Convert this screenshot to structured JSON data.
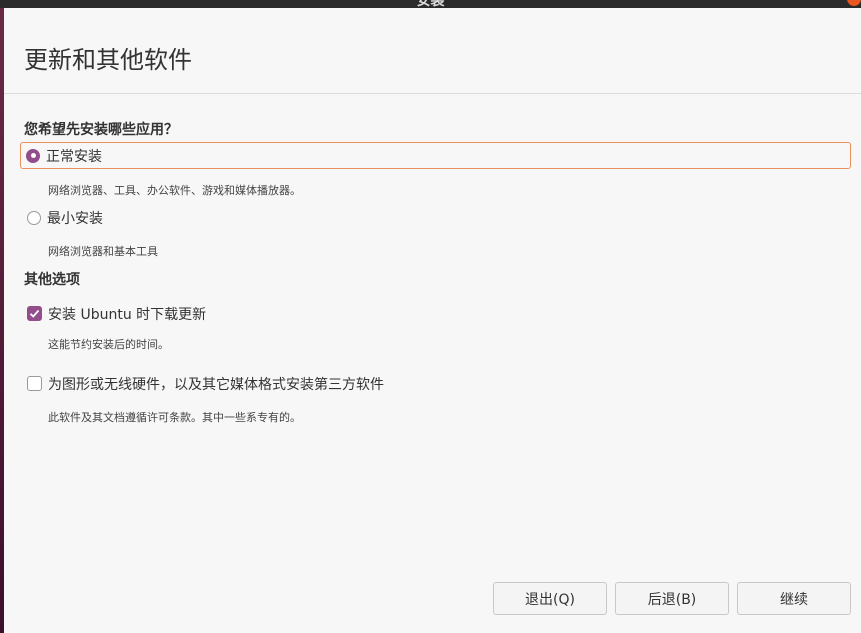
{
  "window": {
    "title": "安装"
  },
  "header": {
    "title": "更新和其他软件"
  },
  "install_type": {
    "question": "您希望先安装哪些应用？",
    "options": [
      {
        "label": "正常安装",
        "description": "网络浏览器、工具、办公软件、游戏和媒体播放器。",
        "selected": true
      },
      {
        "label": "最小安装",
        "description": "网络浏览器和基本工具",
        "selected": false
      }
    ]
  },
  "other_options": {
    "heading": "其他选项",
    "items": [
      {
        "label": "安装 Ubuntu 时下载更新",
        "description": "这能节约安装后的时间。",
        "checked": true
      },
      {
        "label": "为图形或无线硬件，以及其它媒体格式安装第三方软件",
        "description": "此软件及其文档遵循许可条款。其中一些系专有的。",
        "checked": false
      }
    ]
  },
  "buttons": {
    "quit": "退出(Q)",
    "back": "后退(B)",
    "continue": "继续"
  },
  "colors": {
    "accent": "#924d8b",
    "focus": "#e9905f",
    "close": "#e95420"
  }
}
